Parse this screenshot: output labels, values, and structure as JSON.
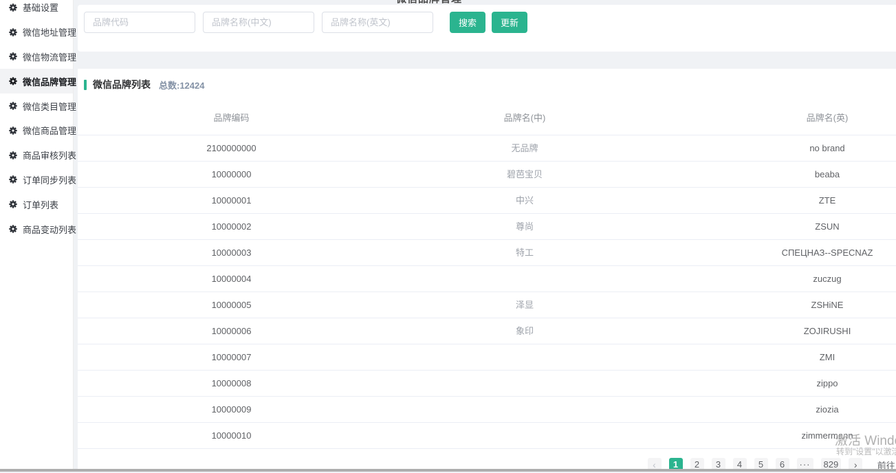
{
  "accent_color": "#2bb48f",
  "top_bar": {
    "clipped_title": "微信品牌管理"
  },
  "sidebar": {
    "items": [
      {
        "label": "基础设置",
        "active": false
      },
      {
        "label": "微信地址管理",
        "active": false
      },
      {
        "label": "微信物流管理",
        "active": false
      },
      {
        "label": "微信品牌管理",
        "active": true
      },
      {
        "label": "微信类目管理",
        "active": false
      },
      {
        "label": "微信商品管理",
        "active": false
      },
      {
        "label": "商品审核列表",
        "active": false
      },
      {
        "label": "订单同步列表",
        "active": false
      },
      {
        "label": "订单列表",
        "active": false
      },
      {
        "label": "商品变动列表",
        "active": false
      }
    ],
    "item_icon": "gear-icon"
  },
  "search": {
    "inputs": [
      {
        "placeholder": "品牌代码",
        "value": ""
      },
      {
        "placeholder": "品牌名称(中文)",
        "value": ""
      },
      {
        "placeholder": "品牌名称(英文)",
        "value": ""
      }
    ],
    "search_label": "搜索",
    "update_label": "更新"
  },
  "table": {
    "title": "微信品牌列表",
    "total_label": "总数:12424",
    "columns": [
      "品牌编码",
      "品牌名(中)",
      "品牌名(英)"
    ],
    "rows": [
      [
        "2100000000",
        "无品牌",
        "no brand"
      ],
      [
        "10000000",
        "碧芭宝贝",
        "beaba"
      ],
      [
        "10000001",
        "中兴",
        "ZTE"
      ],
      [
        "10000002",
        "尊尚",
        "ZSUN"
      ],
      [
        "10000003",
        "特工",
        "СПЕЦНАЗ--SPECNAZ"
      ],
      [
        "10000004",
        "",
        "zuczug"
      ],
      [
        "10000005",
        "泽显",
        "ZSHiNE"
      ],
      [
        "10000006",
        "象印",
        "ZOJIRUSHI"
      ],
      [
        "10000007",
        "",
        "ZMI"
      ],
      [
        "10000008",
        "",
        "zippo"
      ],
      [
        "10000009",
        "",
        "ziozia"
      ],
      [
        "10000010",
        "",
        "zimmermann"
      ]
    ]
  },
  "pagination": {
    "prev_icon": "‹",
    "next_icon": "›",
    "ellipsis": "···",
    "pages": [
      "1",
      "2",
      "3",
      "4",
      "5",
      "6"
    ],
    "last_page": "829",
    "active_page": "1",
    "goto_label": "前往",
    "goto_value": ""
  },
  "watermark": {
    "line1": "激活 Windows",
    "line2": "转到\"设置\"以激活 Windows。"
  }
}
